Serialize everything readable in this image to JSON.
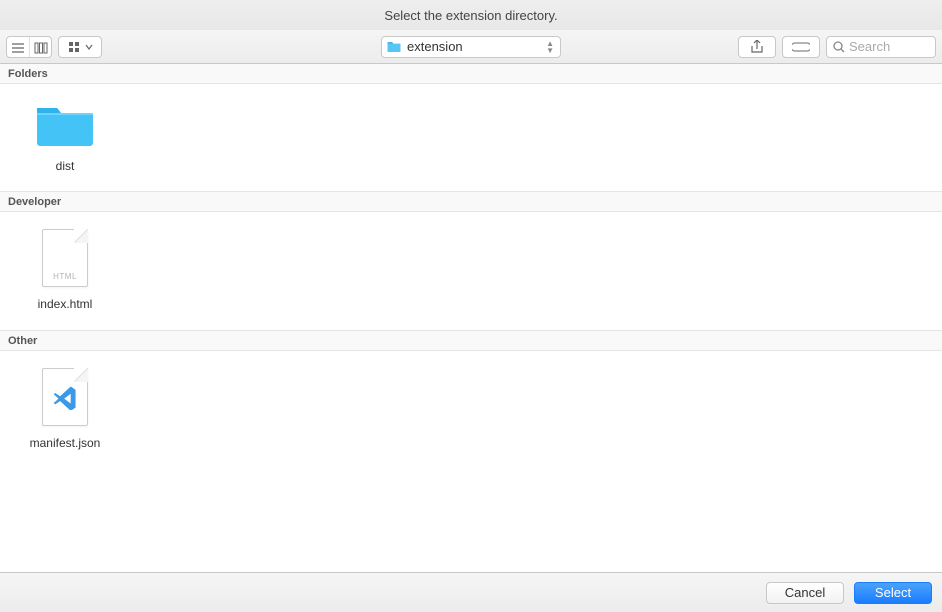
{
  "title": "Select the extension directory.",
  "current_folder": "extension",
  "search": {
    "placeholder": "Search"
  },
  "sections": {
    "folders": {
      "label": "Folders",
      "item": "dist"
    },
    "developer": {
      "label": "Developer",
      "item": "index.html",
      "doc_tag": "HTML"
    },
    "other": {
      "label": "Other",
      "item": "manifest.json"
    }
  },
  "buttons": {
    "cancel": "Cancel",
    "select": "Select"
  }
}
